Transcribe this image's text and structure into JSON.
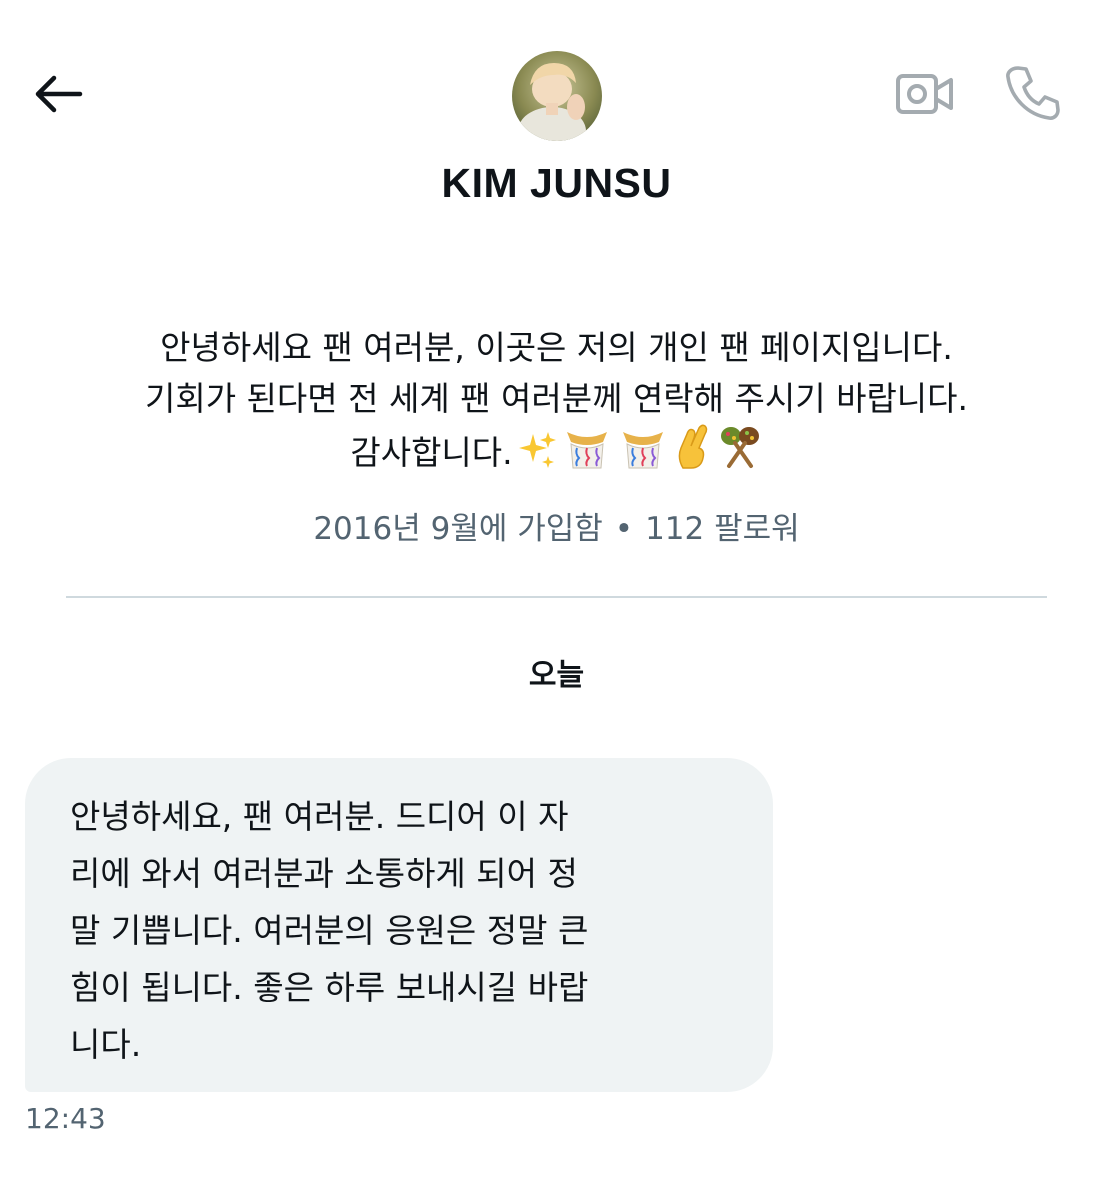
{
  "header": {
    "back_icon": "arrow-left-icon",
    "video_icon": "video-camera-icon",
    "phone_icon": "phone-icon",
    "icon_color": "#0f1419",
    "action_icon_color": "#a4abb0"
  },
  "profile": {
    "name": "KIM JUNSU",
    "bio_lines": [
      "안녕하세요 팬 여러분, 이곳은 저의 개인 팬 페이지입니다.",
      "기회가 된다면 전 세계 팬 여러분께 연락해 주시기 바랍니다.",
      "감사합니다."
    ],
    "bio_emojis": [
      "sparkles-icon",
      "confetti-ball-icon",
      "confetti-ball-icon",
      "crossed-fingers-icon",
      "maracas-icon"
    ],
    "joined": "2016년 9월에 가입함",
    "separator": "•",
    "followers": "112 팔로워"
  },
  "conversation": {
    "date_label": "오늘",
    "messages": [
      {
        "lines": [
          "안녕하세요, 팬 여러분. 드디어 이 자",
          "리에 와서 여러분과 소통하게 되어 정",
          "말 기쁩니다. 여러분의 응원은 정말 큰",
          "힘이 됩니다. 좋은 하루 보내시길 바랍",
          "니다."
        ],
        "time": "12:43",
        "bubble_color": "#eff3f4"
      }
    ]
  }
}
